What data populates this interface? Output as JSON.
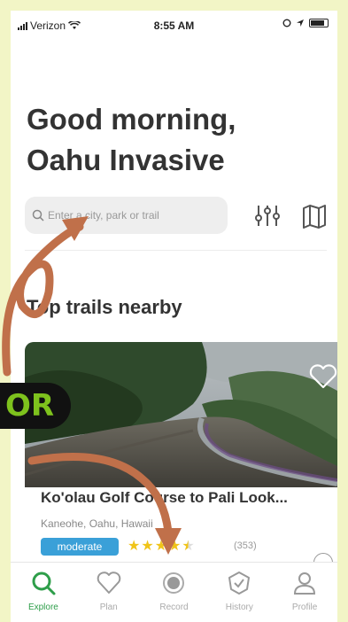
{
  "status_bar": {
    "carrier": "Verizon",
    "time": "8:55 AM"
  },
  "greeting": {
    "line1": "Good morning,",
    "line2": "Oahu Invasive"
  },
  "search": {
    "placeholder": "Enter a city, park or trail"
  },
  "section": {
    "title": "Top trails nearby"
  },
  "trail": {
    "name": "Ko'olau Golf Course to Pali Look...",
    "location": "Kaneohe, Oahu, Hawaii",
    "difficulty": "moderate",
    "rating": 4.5,
    "reviews": "(353)"
  },
  "tabs": [
    {
      "label": "Explore",
      "icon": "search-icon"
    },
    {
      "label": "Plan",
      "icon": "heart-icon"
    },
    {
      "label": "Record",
      "icon": "record-icon"
    },
    {
      "label": "History",
      "icon": "checkmark-badge-icon"
    },
    {
      "label": "Profile",
      "icon": "person-icon"
    }
  ],
  "overlay": {
    "badge": "OR"
  },
  "colors": {
    "frame": "#f2f5c6",
    "active_tab": "#2e9e4a",
    "difficulty_badge": "#3aa0d8",
    "star": "#f0c419",
    "arrow": "#c0704a",
    "badge_text": "#7ec21d"
  }
}
